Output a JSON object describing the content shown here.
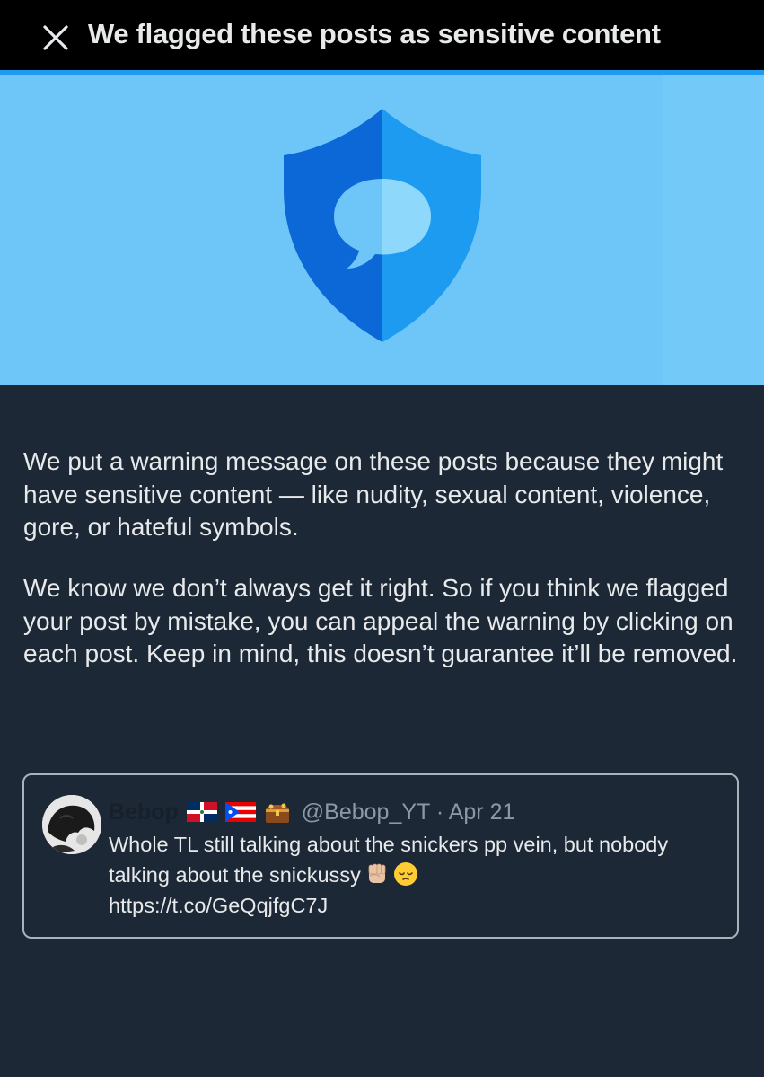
{
  "header": {
    "title": "We flagged these posts as sensitive content",
    "close_icon": "close-icon"
  },
  "hero": {
    "icon": "shield-message-icon",
    "background_color": "#6ec6f8",
    "shield_dark": "#0c68d6",
    "shield_light": "#1d9bf0"
  },
  "explanation": {
    "paragraph1": "We put a warning message on these posts because they might have sensitive content — like nudity, sexual content, violence, gore, or hateful symbols.",
    "paragraph2": "We know we don’t always get it right. So if you think we flagged your post by mistake, you can appeal the warning by clicking on each post. Keep in mind, this doesn’t guarantee it’ll be removed."
  },
  "post": {
    "author_name": "Bebop",
    "author_flags": [
      "dominican-republic-flag-icon",
      "puerto-rico-flag-icon",
      "treasure-chest-icon"
    ],
    "handle": "@Bebop_YT",
    "separator": "·",
    "date": "Apr 21",
    "text": "Whole TL still talking about the snickers pp vein, but nobody talking about the snickussy",
    "emojis": [
      "raised-fist-icon",
      "pensive-face-icon"
    ],
    "link": "https://t.co/GeQqjfgC7J"
  },
  "colors": {
    "page_background": "#1c2836",
    "topbar_background": "#000000",
    "accent": "#1d9bf0",
    "text_primary": "#e7e9ea",
    "text_secondary": "#8b98a5"
  }
}
